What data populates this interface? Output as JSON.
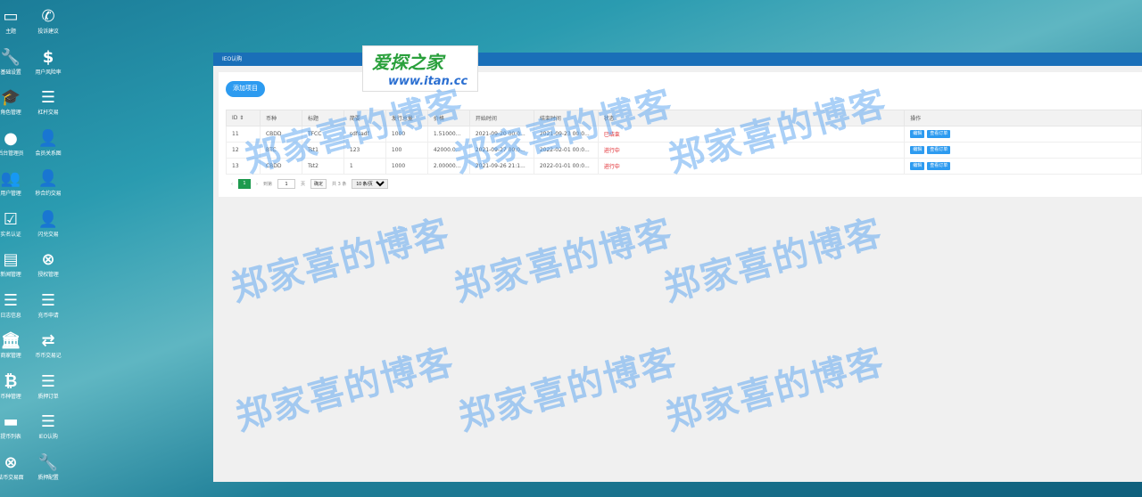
{
  "desktop": {
    "left_column": [
      {
        "icon": "monitor-icon",
        "glyph": "▭",
        "label": "主题"
      },
      {
        "icon": "wrench-icon",
        "glyph": "🔧",
        "label": "基础设置"
      },
      {
        "icon": "graduation-icon",
        "glyph": "🎓",
        "label": "角色管理"
      },
      {
        "icon": "user-circle-icon",
        "glyph": "●",
        "label": "后台管理员"
      },
      {
        "icon": "users-icon",
        "glyph": "👥",
        "label": "用户管理"
      },
      {
        "icon": "check-icon",
        "glyph": "☑",
        "label": "实名认证"
      },
      {
        "icon": "news-icon",
        "glyph": "▤",
        "label": "新闻管理"
      },
      {
        "icon": "list-icon",
        "glyph": "☰",
        "label": "日志信息"
      },
      {
        "icon": "bank-icon",
        "glyph": "🏛",
        "label": "商家管理"
      },
      {
        "icon": "bitcoin-icon",
        "glyph": "₿",
        "label": "币种管理"
      },
      {
        "icon": "card-icon",
        "glyph": "▬",
        "label": "提币列表"
      },
      {
        "icon": "link-icon",
        "glyph": "⊗",
        "label": "法币交易面"
      }
    ],
    "right_column": [
      {
        "icon": "phone-icon",
        "glyph": "✆",
        "label": "投诉建议"
      },
      {
        "icon": "dollar-icon",
        "glyph": "$",
        "label": "用户风险率"
      },
      {
        "icon": "list-icon",
        "glyph": "☰",
        "label": "杠杆交易"
      },
      {
        "icon": "user-plus-icon",
        "glyph": "👤",
        "label": "会员关系图"
      },
      {
        "icon": "user-plus-icon",
        "glyph": "👤",
        "label": "秒合约交易"
      },
      {
        "icon": "user-plus-icon",
        "glyph": "👤",
        "label": "闪兑交易"
      },
      {
        "icon": "link-icon",
        "glyph": "⊗",
        "label": "授权管理"
      },
      {
        "icon": "list-icon",
        "glyph": "☰",
        "label": "充币申请"
      },
      {
        "icon": "transfer-icon",
        "glyph": "⇄",
        "label": "币币交易记"
      },
      {
        "icon": "list-icon",
        "glyph": "☰",
        "label": "质押订单"
      },
      {
        "icon": "list-icon",
        "glyph": "☰",
        "label": "IEO认购"
      },
      {
        "icon": "wrench-icon",
        "glyph": "🔧",
        "label": "质押配置"
      }
    ]
  },
  "window": {
    "title": "IEO认购",
    "add_button": "添加项目",
    "columns": [
      "ID ⇕",
      "币种",
      "标题",
      "简要",
      "发行总量",
      "价格",
      "开始时间",
      "结束时间",
      "状态",
      "操作"
    ],
    "rows": [
      {
        "id": "11",
        "coin": "CBDD",
        "title": "TFCC",
        "brief": "sdfsadf",
        "total": "1000",
        "price": "1.51000...",
        "start": "2021-09-20 00:0...",
        "end": "2021-09-23 00:0...",
        "status": "已结束"
      },
      {
        "id": "12",
        "coin": "BTC",
        "title": "Tst1",
        "brief": "123",
        "total": "100",
        "price": "42000.0...",
        "start": "2021-09-27 00:0...",
        "end": "2022-02-01 00:0...",
        "status": "进行中"
      },
      {
        "id": "13",
        "coin": "CBDD",
        "title": "Tst2",
        "brief": "1",
        "total": "1000",
        "price": "2.00000...",
        "start": "2021-09-26 21:1...",
        "end": "2022-01-01 00:0...",
        "status": "进行中"
      }
    ],
    "edit_label": "编辑",
    "view_orders_label": "查看订单",
    "pager": {
      "prev": "‹",
      "current": "1",
      "next": "›",
      "goto_label": "到第",
      "page_value": "1",
      "page_unit": "页",
      "confirm": "确定",
      "total": "共 3 条",
      "per_page": "10 条/页"
    }
  },
  "logo": {
    "line1": "爱探之家",
    "line2": "www.itan.cc"
  },
  "watermark": "郑家喜的博客",
  "colors": {
    "accent": "#2d9bf0",
    "title_bar": "#1a6fb8",
    "status_red": "#e0262b",
    "pager_active": "#1e9a4e"
  }
}
